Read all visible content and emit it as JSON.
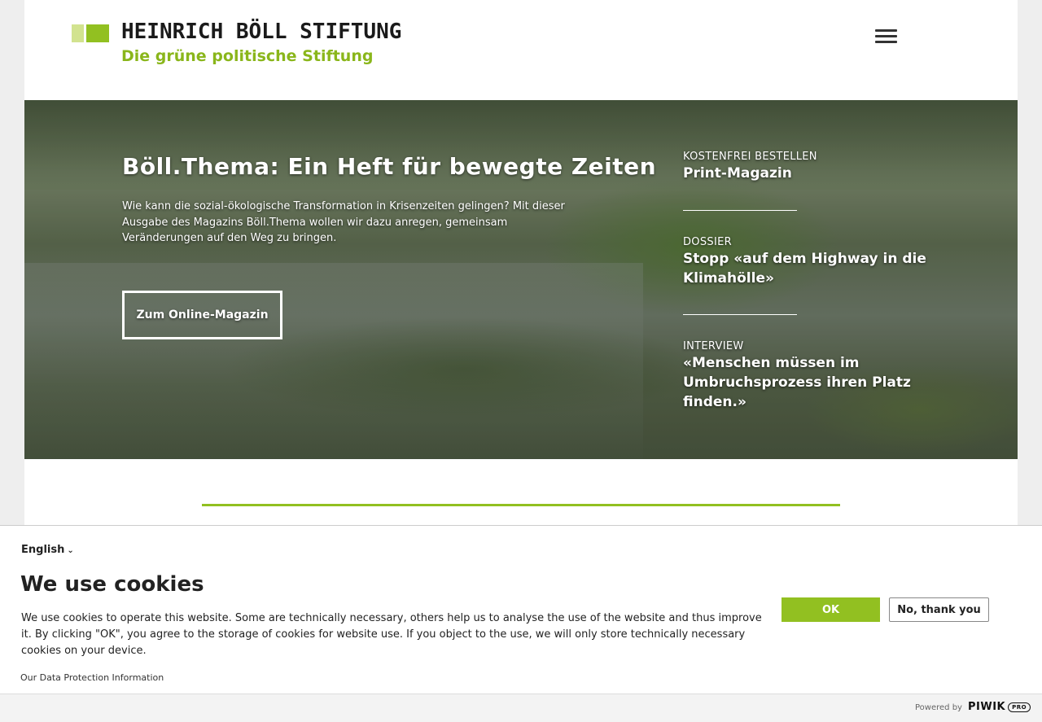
{
  "header": {
    "logo_name": "HEINRICH BÖLL STIFTUNG",
    "logo_tagline": "Die grüne politische Stiftung",
    "menu_icon": "hamburger-menu-icon"
  },
  "hero": {
    "title": "Böll.Thema: Ein Heft für bewegte Zeiten",
    "description": "Wie kann die sozial-ökologische Transformation in Krisenzeiten gelingen? Mit dieser Ausgabe des Magazins Böll.Thema wollen wir dazu anregen, gemeinsam Veränderungen auf den Weg zu bringen.",
    "button_label": "Zum Online-Magazin",
    "teasers": [
      {
        "kicker": "KOSTENFREI BESTELLEN",
        "title": "Print-Magazin"
      },
      {
        "kicker": "DOSSIER",
        "title": "Stopp «auf dem Highway in die Klimahölle»"
      },
      {
        "kicker": "INTERVIEW",
        "title": "«Menschen müssen im Umbruchsprozess ihren Platz finden.»"
      }
    ]
  },
  "cookie": {
    "language": "English",
    "title": "We use cookies",
    "text": "We use cookies to operate this website. Some are technically necessary, others help us to analyse the use of the website and thus improve it. By clicking \"OK\", you agree to the storage of cookies for website use. If you object to the use, we will only store technically necessary cookies on your device.",
    "privacy_link": "Our Data Protection Information",
    "ok_label": "OK",
    "no_label": "No, thank you"
  },
  "footer": {
    "powered_by": "Powered by",
    "brand": "PIWIK",
    "brand_suffix": "PRO"
  },
  "colors": {
    "accent_green": "#92c021",
    "light_green": "#d2e38f"
  }
}
